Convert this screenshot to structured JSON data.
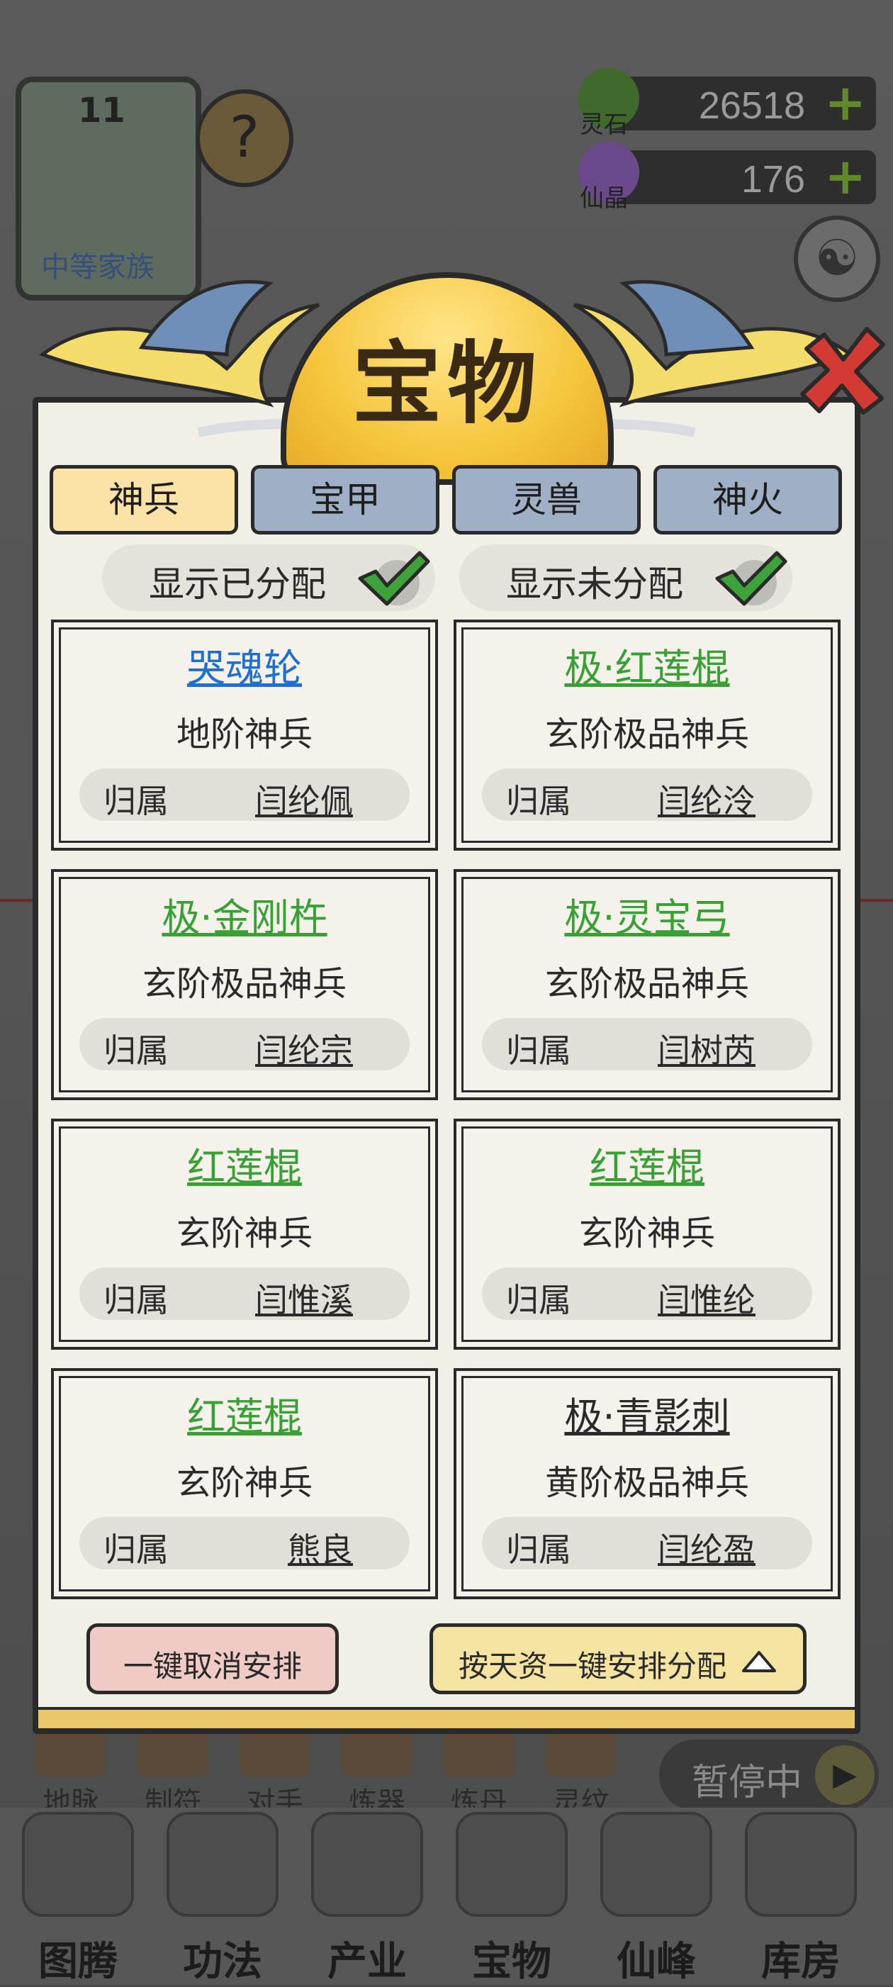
{
  "resources": [
    {
      "name": "灵石",
      "value": "26518",
      "plus": "+",
      "color": "#3f6a2c"
    },
    {
      "name": "仙晶",
      "value": "176",
      "plus": "+",
      "color": "#6a4a8a"
    }
  ],
  "family": {
    "level": "11",
    "rank": "中等家族",
    "help": "?"
  },
  "gear_glyph": "☯",
  "quick_menu": [
    "地脉",
    "制符",
    "对手",
    "炼器",
    "炼丹",
    "灵纹"
  ],
  "pause": {
    "label": "暂停中",
    "play_glyph": "▶"
  },
  "bottom_nav": [
    "图腾",
    "功法",
    "产业",
    "宝物",
    "仙峰",
    "库房"
  ],
  "dialog": {
    "title": "宝物",
    "tabs": [
      {
        "label": "神兵",
        "active": true
      },
      {
        "label": "宝甲",
        "active": false
      },
      {
        "label": "灵兽",
        "active": false
      },
      {
        "label": "神火",
        "active": false
      }
    ],
    "filters": [
      {
        "label": "显示已分配",
        "checked": true
      },
      {
        "label": "显示未分配",
        "checked": true
      }
    ],
    "owner_label": "归属",
    "items": [
      {
        "name": "哭魂轮",
        "grade": "地阶神兵",
        "owner": "闫纶佩",
        "color": "blue"
      },
      {
        "name": "极·红莲棍",
        "grade": "玄阶极品神兵",
        "owner": "闫纶泠",
        "color": "green"
      },
      {
        "name": "极·金刚杵",
        "grade": "玄阶极品神兵",
        "owner": "闫纶宗",
        "color": "green"
      },
      {
        "name": "极·灵宝弓",
        "grade": "玄阶极品神兵",
        "owner": "闫树芮",
        "color": "green"
      },
      {
        "name": "红莲棍",
        "grade": "玄阶神兵",
        "owner": "闫惟溪",
        "color": "green"
      },
      {
        "name": "红莲棍",
        "grade": "玄阶神兵",
        "owner": "闫惟纶",
        "color": "green"
      },
      {
        "name": "红莲棍",
        "grade": "玄阶神兵",
        "owner": "熊良",
        "color": "green"
      },
      {
        "name": "极·青影刺",
        "grade": "黄阶极品神兵",
        "owner": "闫纶盈",
        "color": "black"
      }
    ],
    "cancel_button": "一键取消安排",
    "arrange_button": "按天资一键安排分配"
  }
}
